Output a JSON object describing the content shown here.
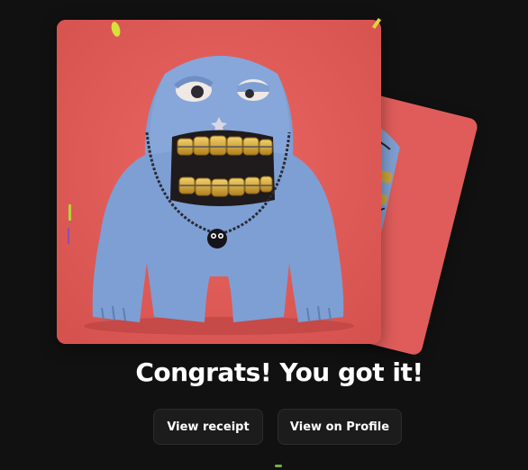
{
  "celebration": {
    "headline": "Congrats! You got it!"
  },
  "actions": {
    "view_receipt_label": "View receipt",
    "view_profile_label": "View on Profile"
  },
  "artwork": {
    "subject": "blue clay monster with gold teeth",
    "background_color": "#e45b57"
  },
  "colors": {
    "page_background": "#111111",
    "button_background": "#1c1c1c",
    "text": "#ffffff"
  }
}
